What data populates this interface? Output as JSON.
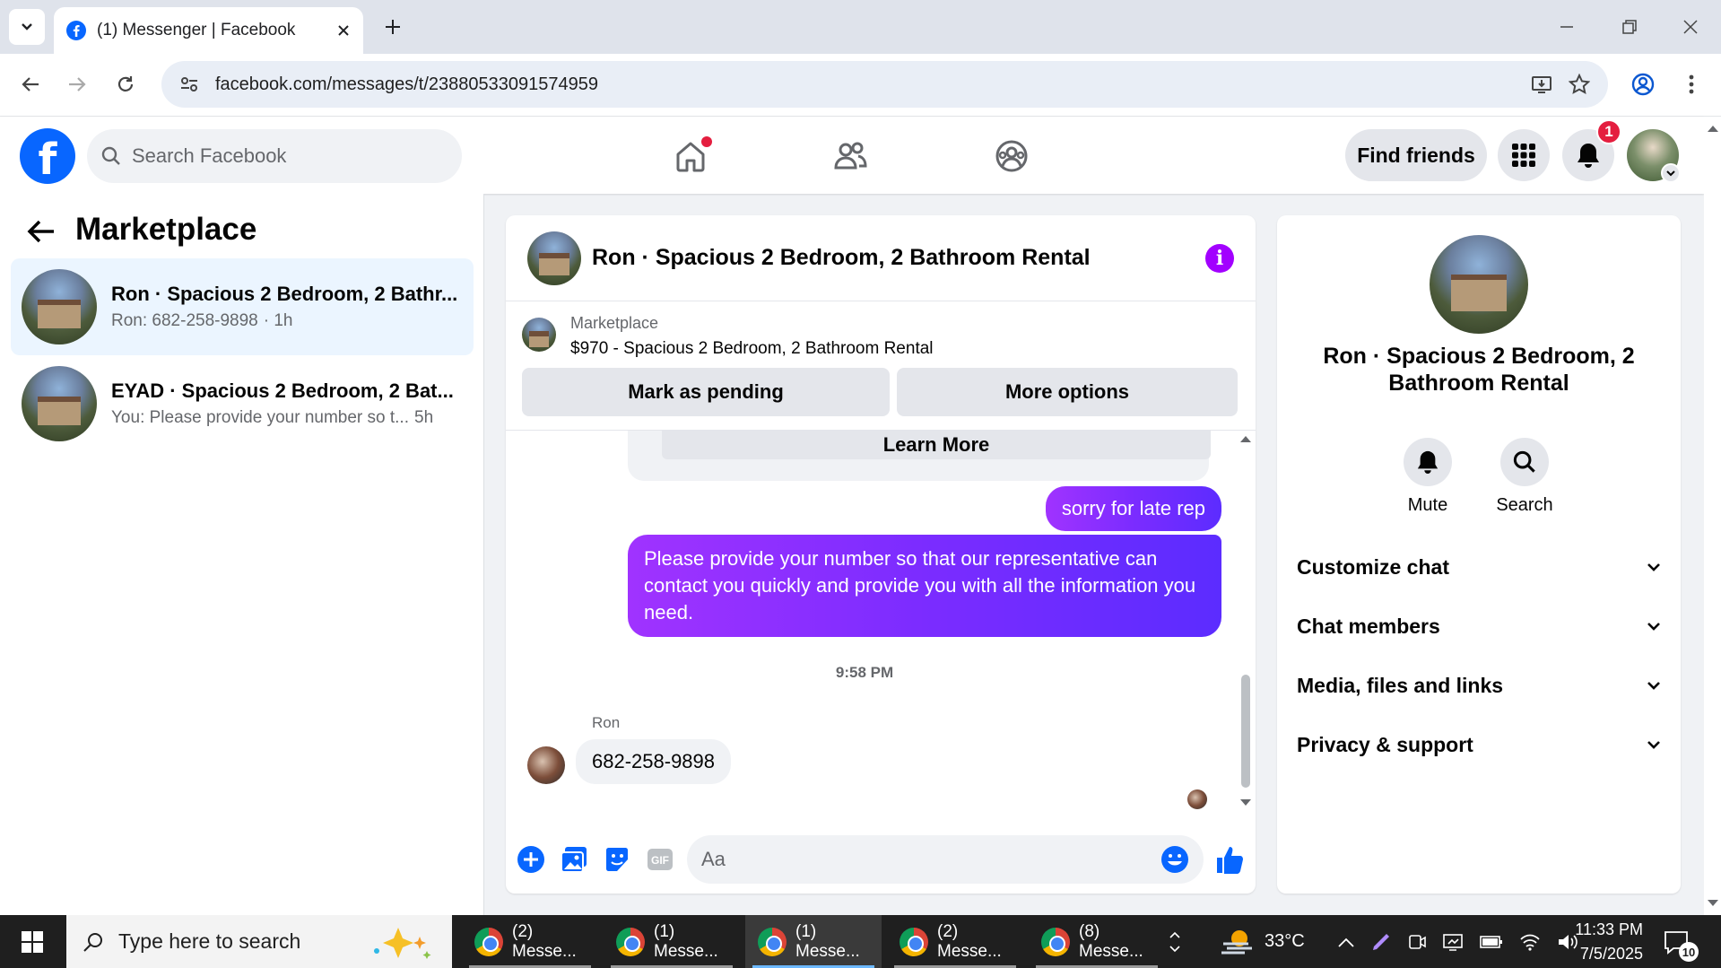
{
  "browser": {
    "tab_title": "(1) Messenger | Facebook",
    "url": "facebook.com/messages/t/23880533091574959"
  },
  "fb_header": {
    "search_placeholder": "Search Facebook",
    "find_friends": "Find friends",
    "notification_count": "1"
  },
  "left_panel": {
    "title": "Marketplace",
    "conversations": [
      {
        "name": "Ron · Spacious 2 Bedroom, 2 Bathr...",
        "snippet": "Ron: 682-258-9898",
        "time": "· 1h"
      },
      {
        "name": "EYAD · Spacious 2 Bedroom, 2 Bat...",
        "snippet": "You: Please provide your number so t...",
        "time": "5h"
      }
    ]
  },
  "chat": {
    "title": "Ron · Spacious 2 Bedroom, 2 Bathroom Rental",
    "marketplace_label": "Marketplace",
    "listing": "$970 - Spacious 2 Bedroom, 2 Bathroom Rental",
    "mark_pending": "Mark as pending",
    "more_options": "More options",
    "learn_more": "Learn More",
    "messages": {
      "out1": "sorry for late rep",
      "out2": "Please provide your number so that our representative can contact you quickly and provide you with all the information you need.",
      "timestamp": "9:58 PM",
      "sender": "Ron",
      "in1": "682-258-9898"
    },
    "composer_placeholder": "Aa"
  },
  "right_panel": {
    "name": "Ron · Spacious 2 Bedroom, 2 Bathroom Rental",
    "mute": "Mute",
    "search": "Search",
    "sections": [
      "Customize chat",
      "Chat members",
      "Media, files and links",
      "Privacy & support"
    ]
  },
  "taskbar": {
    "search_placeholder": "Type here to search",
    "apps": [
      "(2) Messe...",
      "(1) Messe...",
      "(1) Messe...",
      "(2) Messe...",
      "(8) Messe..."
    ],
    "temperature": "33°C",
    "time": "11:33 PM",
    "date": "7/5/2025",
    "notif_count": "10"
  },
  "colors": {
    "fb_blue": "#0866ff",
    "messenger_purple": "#a033ff",
    "badge_red": "#e41e3f"
  }
}
